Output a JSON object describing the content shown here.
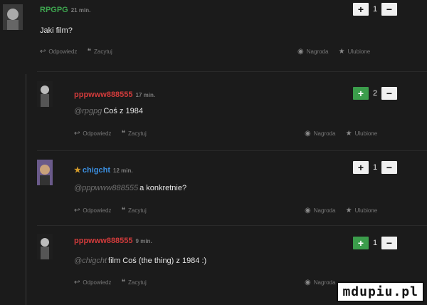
{
  "colors": {
    "background": "#1b1b1b",
    "nick_green": "#3ea54f",
    "nick_red": "#d13b3b",
    "nick_blue": "#3b8fe0",
    "vote_active": "#3b9d4b"
  },
  "actions": {
    "reply": "Odpowiedz",
    "quote": "Zacytuj",
    "award": "Nagroda",
    "favorite": "Ulubione"
  },
  "comments": [
    {
      "author": "RPGPG",
      "time": "21 min.",
      "mention": "",
      "text": "Jaki film?",
      "votes": "1"
    },
    {
      "author": "pppwww888555",
      "time": "17 min.",
      "mention": "@rpgpg",
      "text": "Coś z 1984",
      "votes": "2"
    },
    {
      "author": "chigcht",
      "time": "12 min.",
      "mention": "@pppwww888555",
      "text": "a konkretnie?",
      "votes": "1"
    },
    {
      "author": "pppwww888555",
      "time": "9 min.",
      "mention": "@chigcht",
      "text": "film Coś (the thing) z 1984 :)",
      "votes": "1"
    }
  ],
  "watermark": "mdupiu.pl"
}
